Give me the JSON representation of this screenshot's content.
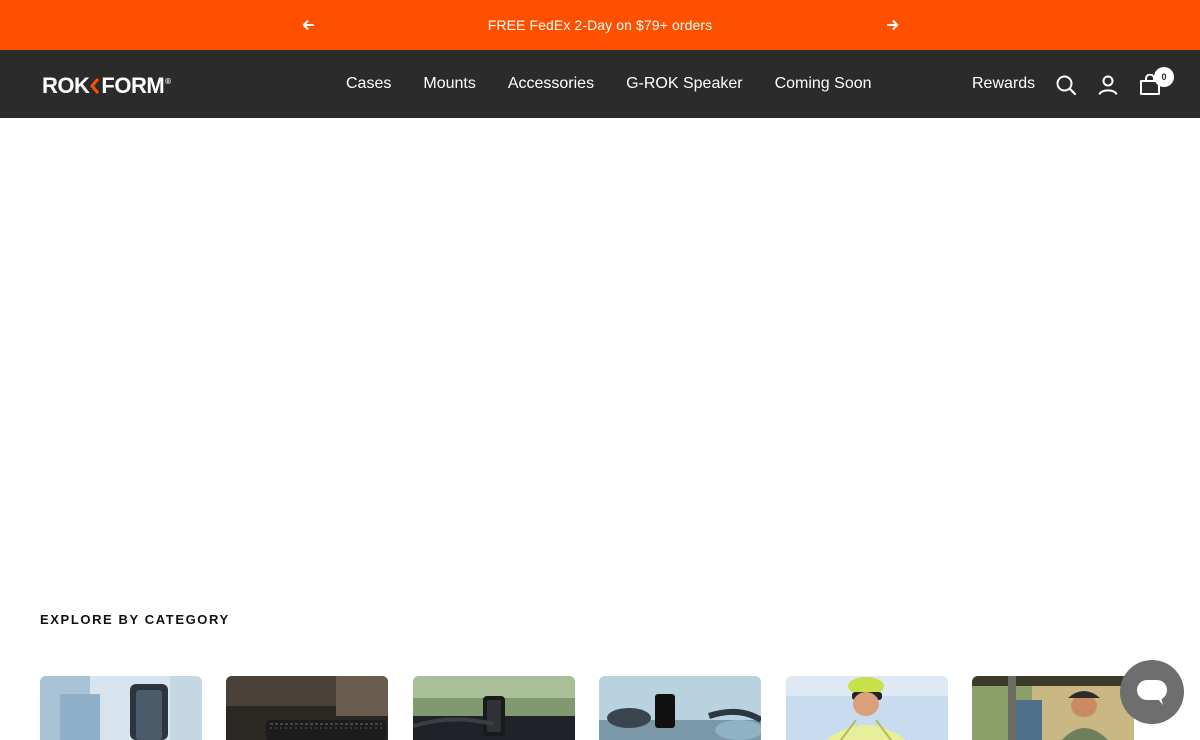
{
  "announcement": {
    "text": "FREE FedEx 2-Day on $79+ orders",
    "prev_icon": "arrow-left-icon",
    "next_icon": "arrow-right-icon",
    "bg_color": "#ff5000"
  },
  "header": {
    "logo": {
      "part1": "ROK",
      "part2": "FORM",
      "reg": "®"
    },
    "bg_color": "#2b2b2b",
    "nav": [
      {
        "label": "Cases"
      },
      {
        "label": "Mounts"
      },
      {
        "label": "Accessories"
      },
      {
        "label": "G-ROK Speaker"
      },
      {
        "label": "Coming Soon"
      }
    ],
    "rewards_label": "Rewards",
    "cart_count": "0",
    "icons": [
      "search-icon",
      "account-icon",
      "cart-icon"
    ]
  },
  "categories": {
    "title": "EXPLORE BY CATEGORY",
    "cards": [
      {
        "name": "category-card-1"
      },
      {
        "name": "category-card-2"
      },
      {
        "name": "category-card-3"
      },
      {
        "name": "category-card-4"
      },
      {
        "name": "category-card-5"
      },
      {
        "name": "category-card-6"
      }
    ]
  },
  "chat": {
    "icon": "chat-bubble-icon"
  }
}
